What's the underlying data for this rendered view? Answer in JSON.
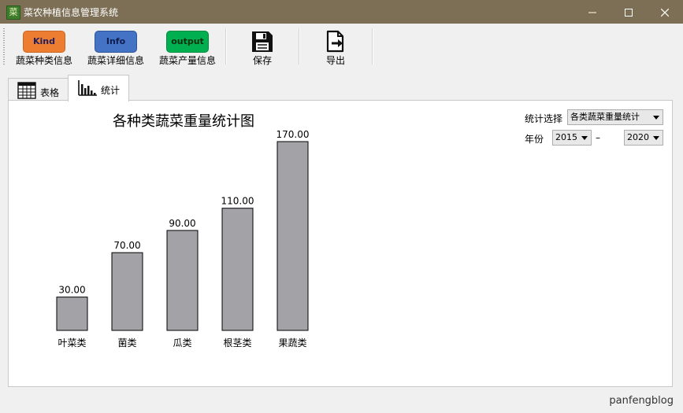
{
  "window": {
    "title": "菜农种植信息管理系统",
    "icon_char": "菜",
    "controls": [
      "minimize-icon",
      "maximize-icon",
      "close-icon"
    ]
  },
  "toolbar": {
    "buttons": [
      {
        "id": "kind",
        "badge": "Kind",
        "badge_color": "#ed7d31",
        "badge_text_color": "#1f1f5f",
        "label": "蔬菜种类信息"
      },
      {
        "id": "info",
        "badge": "Info",
        "badge_color": "#4472c4",
        "badge_text_color": "#0f1f4f",
        "label": "蔬菜详细信息"
      },
      {
        "id": "output",
        "badge": "output",
        "badge_color": "#00b050",
        "badge_text_color": "#0f2f0f",
        "label": "蔬菜产量信息"
      },
      {
        "id": "save",
        "icon": "save-icon",
        "label": "保存"
      },
      {
        "id": "export",
        "icon": "export-icon",
        "label": "导出"
      }
    ]
  },
  "tabs": [
    {
      "label": "表格",
      "icon": "table-icon",
      "active": false
    },
    {
      "label": "统计",
      "icon": "bar-chart-icon",
      "active": true
    }
  ],
  "controls": {
    "stat_label": "统计选择",
    "stat_value": "各类蔬菜重量统计",
    "year_label": "年份",
    "year_from": "2015",
    "year_sep": "–",
    "year_to": "2020"
  },
  "chart_data": {
    "type": "bar",
    "title": "各种类蔬菜重量统计图",
    "categories": [
      "叶菜类",
      "菌类",
      "瓜类",
      "根茎类",
      "果蔬类"
    ],
    "values": [
      30,
      70,
      90,
      110,
      170
    ],
    "value_labels": [
      "30.00",
      "70.00",
      "90.00",
      "110.00",
      "170.00"
    ],
    "bar_color": "#a3a2a7",
    "ylim": [
      0,
      170
    ],
    "grid": false
  },
  "status": {
    "text": "panfengblog"
  }
}
